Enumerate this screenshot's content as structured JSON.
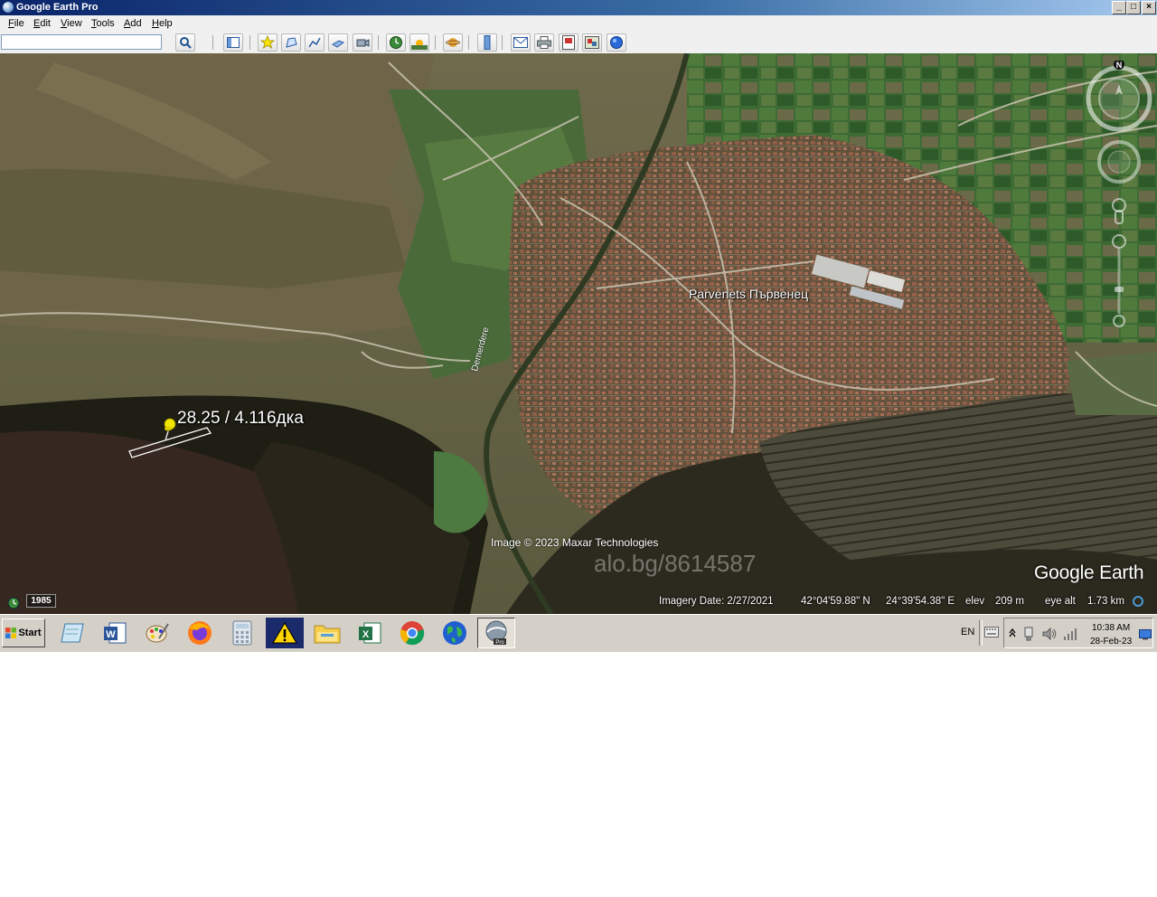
{
  "window": {
    "title": "Google Earth Pro",
    "controls": [
      "minimize",
      "maximize",
      "close"
    ]
  },
  "menu": [
    "File",
    "Edit",
    "View",
    "Tools",
    "Add",
    "Help"
  ],
  "search": {
    "value": "",
    "placeholder": ""
  },
  "toolbar": {
    "buttons": [
      {
        "icon": "search-icon"
      },
      {
        "icon": "sidebar-toggle-icon"
      },
      {
        "icon": "add-placemark-icon"
      },
      {
        "icon": "add-polygon-icon"
      },
      {
        "icon": "add-path-icon"
      },
      {
        "icon": "add-image-overlay-icon"
      },
      {
        "icon": "record-tour-icon"
      },
      {
        "icon": "historical-imagery-icon"
      },
      {
        "icon": "sunlight-icon"
      },
      {
        "icon": "planets-icon"
      },
      {
        "icon": "ruler-icon"
      },
      {
        "icon": "email-icon"
      },
      {
        "icon": "print-icon"
      },
      {
        "icon": "save-image-icon"
      },
      {
        "icon": "view-in-maps-icon"
      },
      {
        "icon": "earth-gallery-icon"
      }
    ]
  },
  "map": {
    "town_label": "Parvenets Първенец",
    "river_label": "Demerdere",
    "placemark_label": "28.25 / 4.116дка",
    "copyright": "Image © 2023 Maxar Technologies",
    "watermark": "alo.bg/8614587",
    "logo": "Google Earth",
    "historical_year": "1985",
    "north_label": "N",
    "status": {
      "imagery_date": "Imagery Date: 2/27/2021",
      "latitude": "42°04'59.88\" N",
      "longitude": "24°39'54.38\" E",
      "elev_label": "elev",
      "elev_value": "209 m",
      "eye_alt_label": "eye alt",
      "eye_alt_value": "1.73 km"
    }
  },
  "taskbar": {
    "start_label": "Start",
    "apps": [
      {
        "icon": "notepad-icon"
      },
      {
        "icon": "word-icon"
      },
      {
        "icon": "paint-icon"
      },
      {
        "icon": "firefox-icon"
      },
      {
        "icon": "calculator-icon"
      },
      {
        "icon": "warning-icon"
      },
      {
        "icon": "file-explorer-icon"
      },
      {
        "icon": "excel-icon"
      },
      {
        "icon": "chrome-icon"
      },
      {
        "icon": "globe-icon"
      },
      {
        "icon": "google-earth-pro-icon",
        "active": true
      }
    ],
    "language": "EN",
    "time": "10:38 AM",
    "date": "28-Feb-23"
  },
  "colors": {
    "titlebar": "#0a246a",
    "taskbar": "#d4d0c8",
    "placemark": "#f2e600"
  }
}
